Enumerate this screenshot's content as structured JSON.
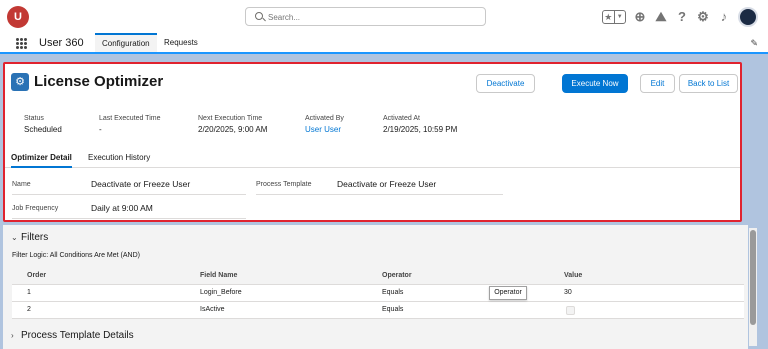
{
  "app": {
    "logo_text": "U",
    "name": "User 360"
  },
  "search": {
    "placeholder": "Search..."
  },
  "top_icons": [
    "favorites-star-icon",
    "add-icon",
    "trailhead-icon",
    "help-icon",
    "settings-gear-icon",
    "bell-icon",
    "avatar"
  ],
  "nav_tabs": [
    {
      "label": "Configuration",
      "active": true
    },
    {
      "label": "Requests",
      "active": false
    }
  ],
  "record": {
    "title": "License Optimizer",
    "buttons": {
      "deactivate": "Deactivate",
      "execute": "Execute Now",
      "edit": "Edit",
      "back": "Back to List"
    },
    "highlights": [
      {
        "label": "Status",
        "value": "Scheduled"
      },
      {
        "label": "Last Executed Time",
        "value": "-"
      },
      {
        "label": "Next Execution Time",
        "value": "2/20/2025, 9:00 AM"
      },
      {
        "label": "Activated By",
        "value": "User User"
      },
      {
        "label": "Activated At",
        "value": "2/19/2025, 10:59 PM"
      }
    ],
    "tabs": [
      {
        "label": "Optimizer Detail",
        "active": true
      },
      {
        "label": "Execution History",
        "active": false
      }
    ],
    "details": {
      "name": {
        "label": "Name",
        "value": "Deactivate or Freeze User"
      },
      "process_template": {
        "label": "Process Template",
        "value": "Deactivate or Freeze User"
      },
      "job_frequency": {
        "label": "Job Frequency",
        "value": "Daily at 9:00 AM"
      }
    }
  },
  "filters": {
    "title": "Filters",
    "logic": "Filter Logic: All Conditions Are Met (AND)",
    "columns": [
      "Order",
      "Field Name",
      "Operator",
      "Value"
    ],
    "rows": [
      {
        "order": "1",
        "field": "Login_Before",
        "operator": "Equals",
        "value": "30"
      },
      {
        "order": "2",
        "field": "IsActive",
        "operator": "Equals",
        "value": ""
      }
    ],
    "tooltip": "Operator"
  },
  "process_section": {
    "title": "Process Template Details"
  },
  "colors": {
    "brand": "#0176d3",
    "highlight_border": "#e0232f",
    "logo": "#c23934"
  }
}
